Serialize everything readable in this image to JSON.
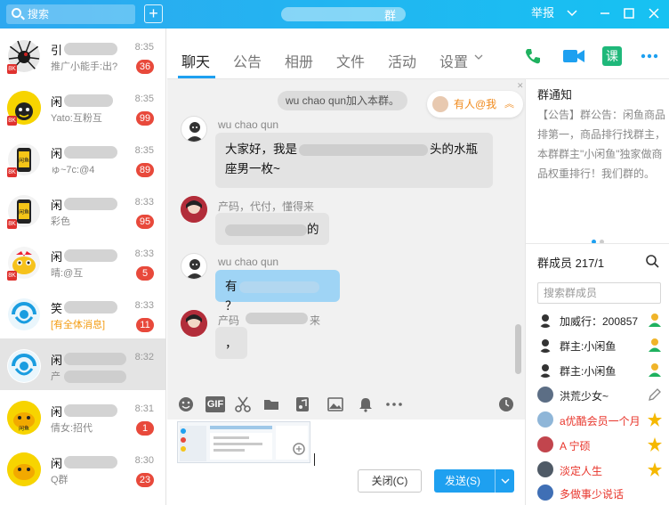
{
  "titlebar": {
    "search_placeholder": "搜索",
    "title_tail": "群",
    "report_label": "举报"
  },
  "conversations": [
    {
      "name": "引",
      "preview": "推广小能手:出?",
      "time": "8:35",
      "count": "36"
    },
    {
      "name": "闲",
      "preview": "Yato:互粉互",
      "time": "8:35",
      "count": "99"
    },
    {
      "name": "闲",
      "preview": "ゅ~7c:@4",
      "time": "8:35",
      "count": "89"
    },
    {
      "name": "闲",
      "preview": "彩色",
      "time": "8:33",
      "count": "95"
    },
    {
      "name": "闲",
      "preview": "晴:@互",
      "time": "8:33",
      "count": "5"
    },
    {
      "name": "笑",
      "preview": "[有全体消息]",
      "time": "8:33",
      "count": "11"
    },
    {
      "name": "闲",
      "preview": "产",
      "time": "8:32",
      "count": ""
    },
    {
      "name": "闲",
      "preview": "倩女:招代",
      "time": "8:31",
      "count": "1"
    },
    {
      "name": "闲",
      "preview": "Q群",
      "time": "8:30",
      "count": "23"
    }
  ],
  "tabs": [
    "聊天",
    "公告",
    "相册",
    "文件",
    "活动",
    "设置"
  ],
  "header_icons": {
    "ke_label": "课"
  },
  "chat": {
    "system_notice": "wu chao qun加入本群。",
    "mention": "有人@我",
    "messages": [
      {
        "sender": "wu chao qun",
        "line1": "大家好，我是",
        "line1_tail": "头的水瓶",
        "line2": "座男一枚~"
      },
      {
        "sender": "产码，代付，懂得来",
        "text": "的"
      },
      {
        "sender": "wu chao qun",
        "text": "有",
        "text_tail": "？"
      },
      {
        "sender": "产码",
        "sender_tail": "来",
        "text": "，"
      }
    ]
  },
  "composer": {
    "close_label": "关闭(C)",
    "send_label": "发送(S)"
  },
  "right_panel": {
    "notice_title": "群通知",
    "notice_text": "【公告】群公告：闲鱼商品排第一，商品排行找群主，本群群主\"小闲鱼\"独家做商品权重排行！我们群的。",
    "members_title": "群成员 217/1",
    "member_search_placeholder": "搜索群成员",
    "members": [
      {
        "name": "加威行：200857",
        "icon": "person-icon",
        "red": false
      },
      {
        "name": "群主:小闲鱼",
        "icon": "person-icon",
        "red": false
      },
      {
        "name": "群主:小闲鱼",
        "icon": "person-icon",
        "red": false
      },
      {
        "name": "洪荒少女~",
        "icon": "pencil-icon",
        "red": false
      },
      {
        "name": "a优酷会员一个月",
        "icon": "star-icon",
        "red": true
      },
      {
        "name": "A 宁硕",
        "icon": "star-icon",
        "red": true
      },
      {
        "name": "淡定人生",
        "icon": "star-icon",
        "red": true
      },
      {
        "name": "多做事少说话",
        "icon": "",
        "red": true
      }
    ]
  },
  "colors": {
    "titlebar_start": "#2ea8f0",
    "titlebar_end": "#16c2f2",
    "accent": "#1ea0f0",
    "badge": "#e8493b",
    "mention": "#f08a1c"
  }
}
